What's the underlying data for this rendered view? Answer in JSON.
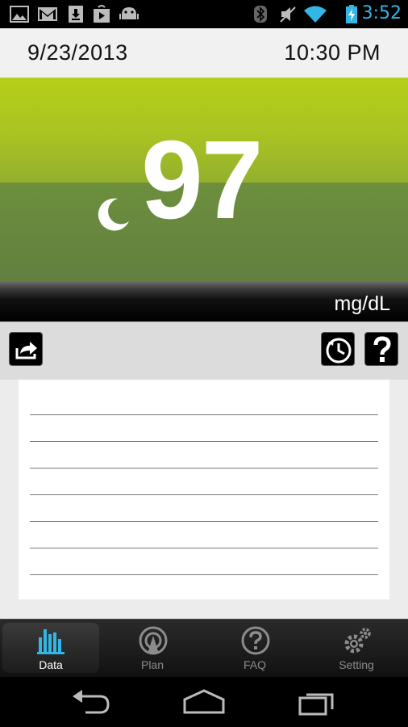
{
  "status_bar": {
    "time": "3:52",
    "icons": [
      "gallery-icon",
      "gmail-icon",
      "download-icon",
      "play-store-icon",
      "android-icon",
      "bluetooth-icon",
      "mute-icon",
      "wifi-icon",
      "battery-charging-icon"
    ],
    "accent_color": "#33b5e5"
  },
  "header": {
    "date": "9/23/2013",
    "time": "10:30 PM"
  },
  "reading": {
    "value": "97",
    "unit": "mg/dL",
    "time_of_day_icon": "moon-icon",
    "panel_color": "#8fae2e"
  },
  "toolbar": {
    "share_icon": "share-icon",
    "history_icon": "clock-refresh-icon",
    "help_icon": "help-icon"
  },
  "notes": {
    "line_count": 7
  },
  "tabs": [
    {
      "label": "Data",
      "icon": "bar-chart-icon",
      "active": true
    },
    {
      "label": "Plan",
      "icon": "plan-icon",
      "active": false
    },
    {
      "label": "FAQ",
      "icon": "question-circle-icon",
      "active": false
    },
    {
      "label": "Setting",
      "icon": "gears-icon",
      "active": false
    }
  ],
  "nav_bar": {
    "back": "back-icon",
    "home": "home-icon",
    "recents": "recents-icon"
  }
}
